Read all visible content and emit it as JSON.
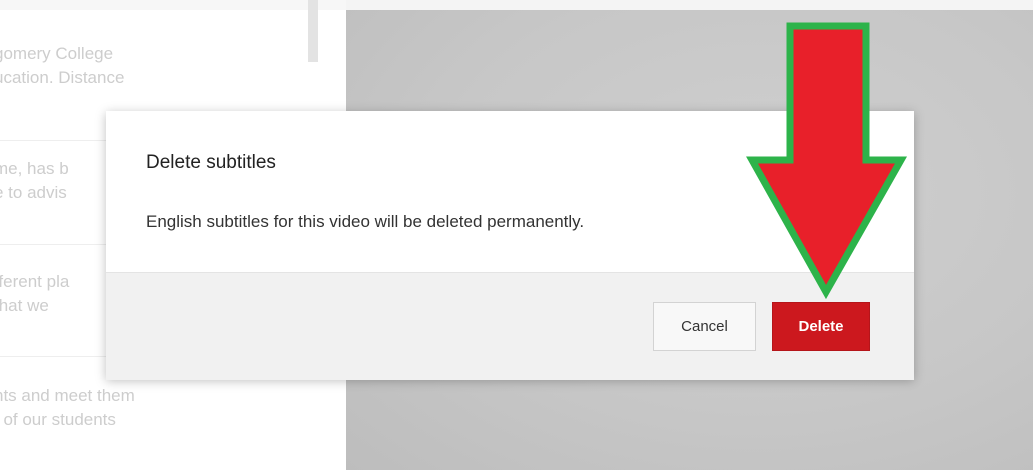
{
  "transcript": {
    "items": [
      {
        "line1": "gomery College",
        "line2": "ucation. Distance"
      },
      {
        "line1": "me, has b",
        "line2": "e to advis"
      },
      {
        "line1": "fferent pla",
        "line2": "that we"
      },
      {
        "line1": "nts and meet them",
        "line2": "t of our students"
      }
    ]
  },
  "dialog": {
    "title": "Delete subtitles",
    "message": "English subtitles for this video will be deleted permanently.",
    "cancel_label": "Cancel",
    "delete_label": "Delete"
  },
  "colors": {
    "delete_button": "#cc181e",
    "arrow_fill": "#e8202a",
    "arrow_outline": "#2db34a"
  },
  "icons": {
    "annotation": "down-arrow-icon"
  }
}
